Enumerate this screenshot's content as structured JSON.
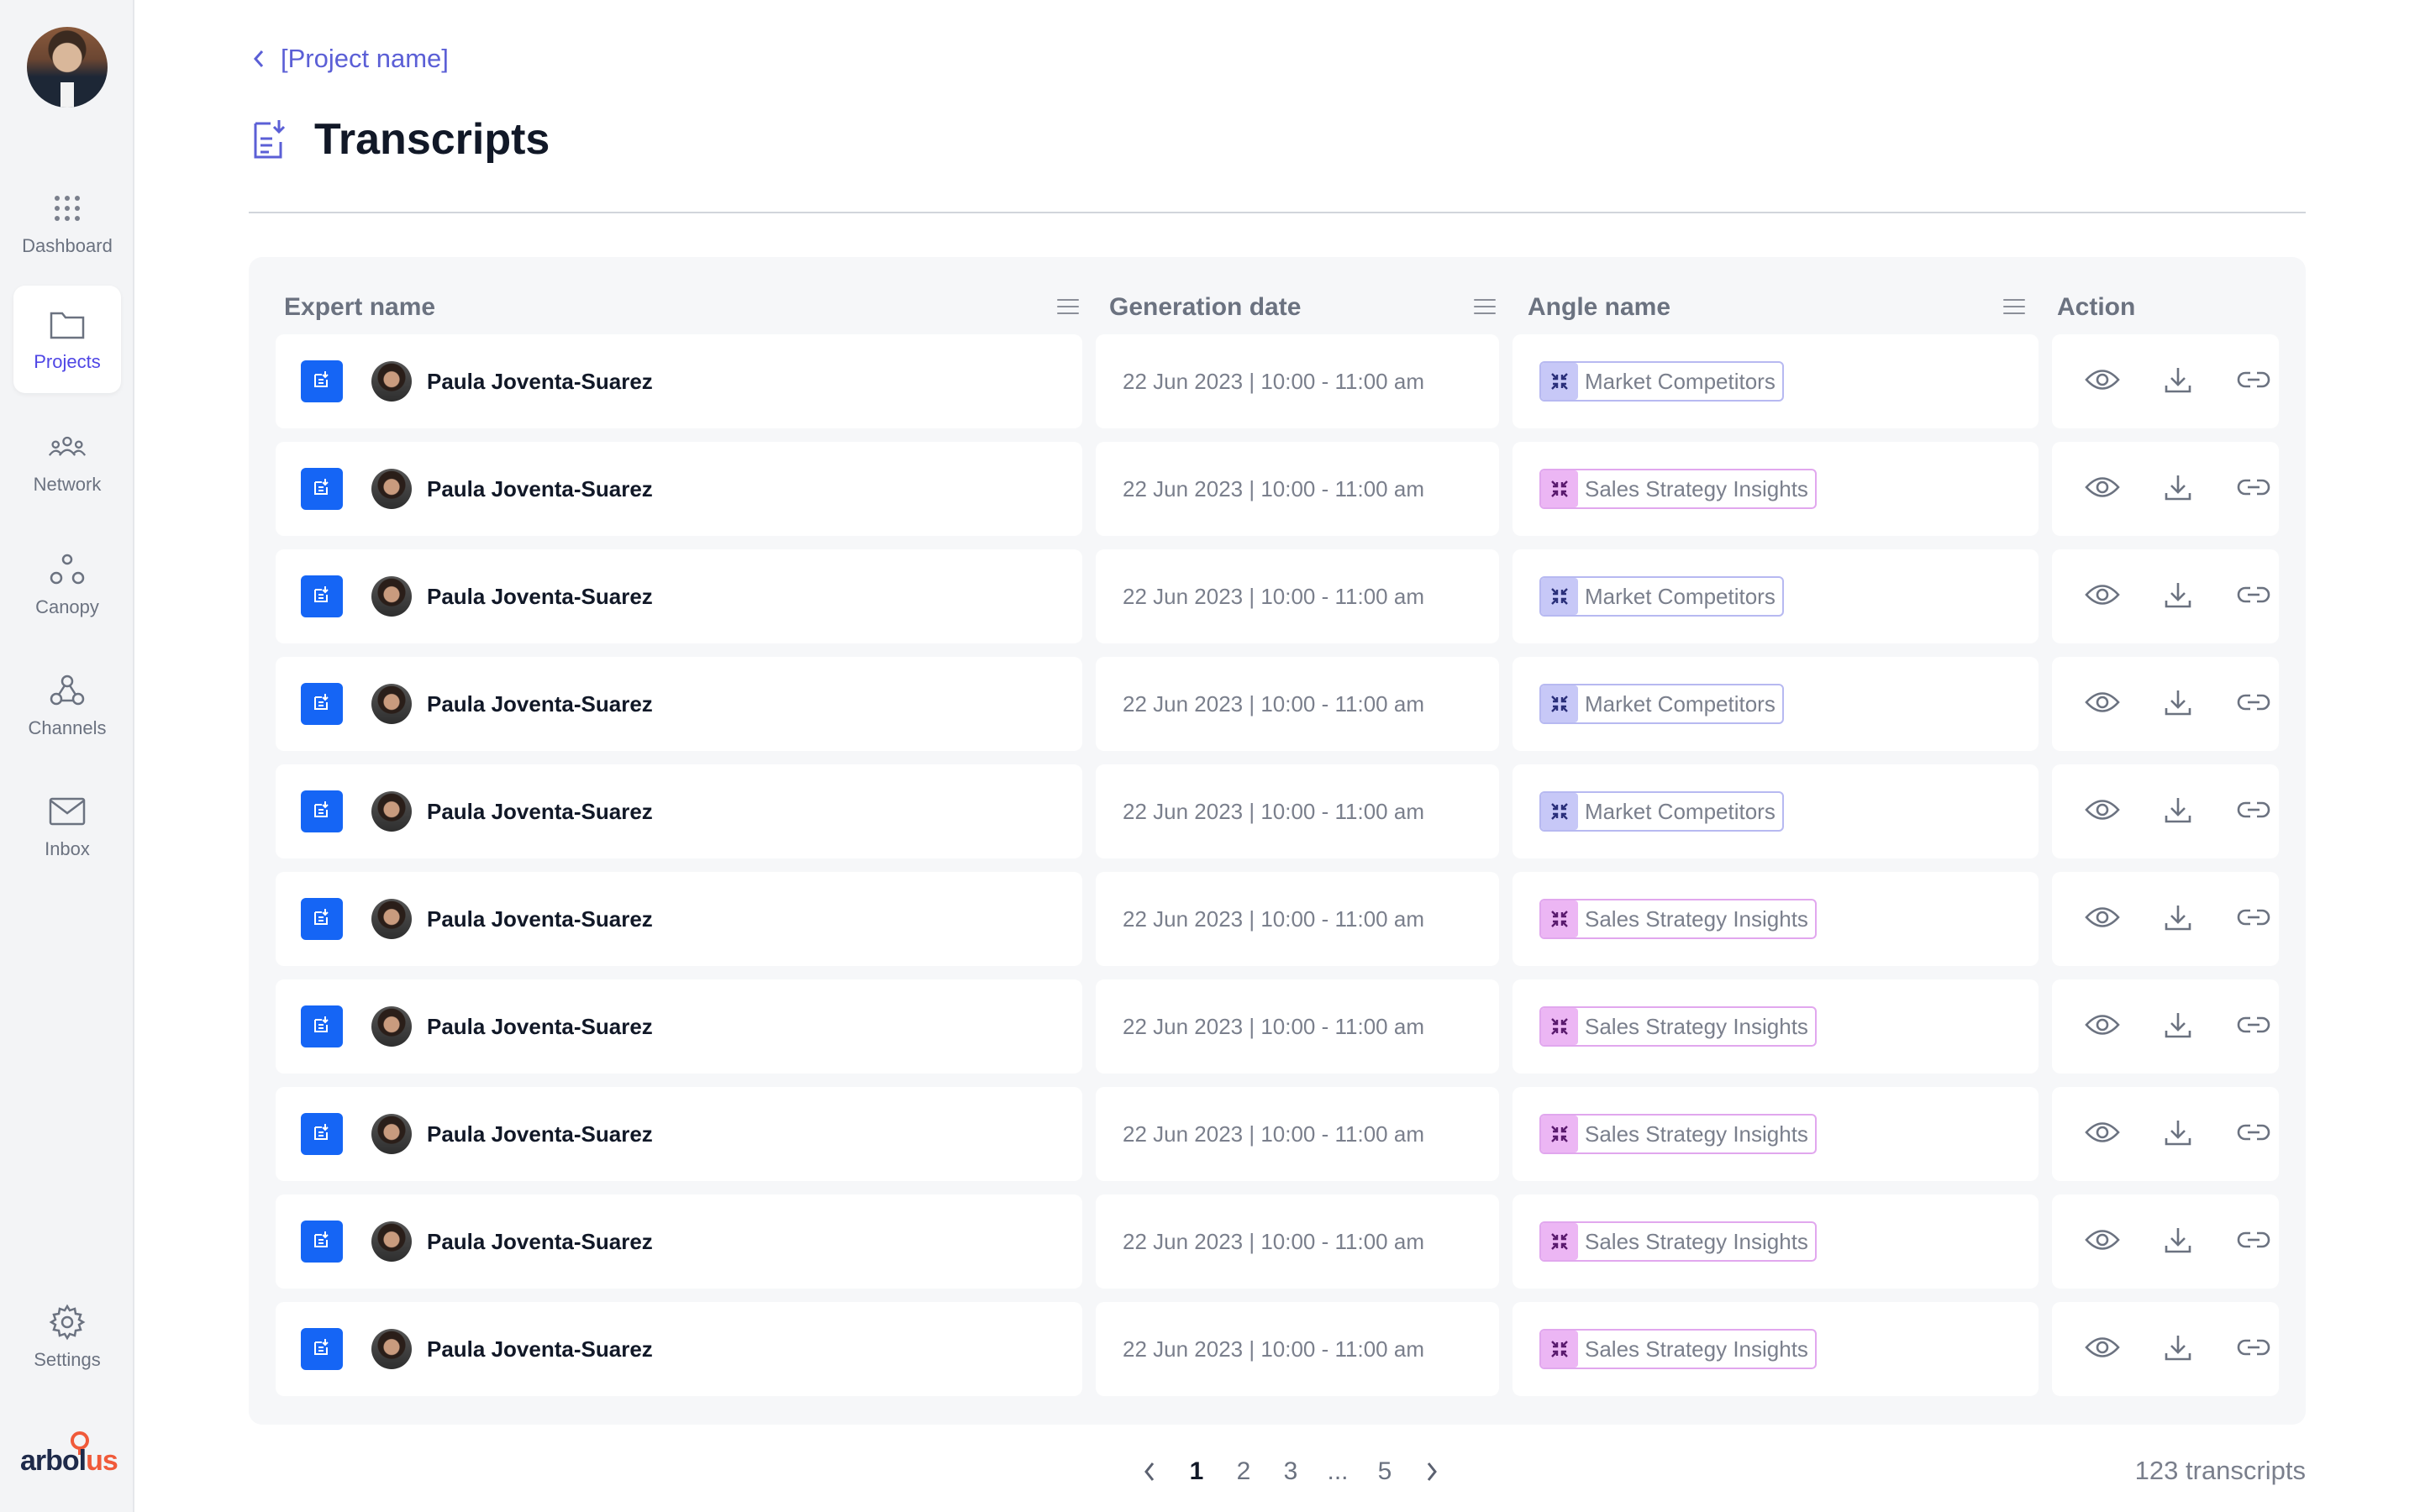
{
  "sidebar": {
    "items": [
      {
        "label": "Dashboard",
        "icon": "grid-dots-icon"
      },
      {
        "label": "Projects",
        "icon": "folder-icon",
        "active": true
      },
      {
        "label": "Network",
        "icon": "people-icon"
      },
      {
        "label": "Canopy",
        "icon": "canopy-icon"
      },
      {
        "label": "Channels",
        "icon": "channels-icon"
      },
      {
        "label": "Inbox",
        "icon": "mail-icon"
      }
    ],
    "settings_label": "Settings",
    "logo_text": "arbolus"
  },
  "breadcrumb": {
    "label": "[Project name]"
  },
  "page": {
    "title": "Transcripts"
  },
  "table": {
    "columns": {
      "expert": "Expert name",
      "date": "Generation date",
      "angle": "Angle name",
      "action": "Action"
    },
    "rows": [
      {
        "expert": "Paula Joventa-Suarez",
        "date": "22 Jun 2023 | 10:00 - 11:00 am",
        "angle": "Market Competitors",
        "angle_color": "blue"
      },
      {
        "expert": "Paula Joventa-Suarez",
        "date": "22 Jun 2023 | 10:00 - 11:00 am",
        "angle": "Sales Strategy Insights",
        "angle_color": "pink"
      },
      {
        "expert": "Paula Joventa-Suarez",
        "date": "22 Jun 2023 | 10:00 - 11:00 am",
        "angle": "Market Competitors",
        "angle_color": "blue"
      },
      {
        "expert": "Paula Joventa-Suarez",
        "date": "22 Jun 2023 | 10:00 - 11:00 am",
        "angle": "Market Competitors",
        "angle_color": "blue"
      },
      {
        "expert": "Paula Joventa-Suarez",
        "date": "22 Jun 2023 | 10:00 - 11:00 am",
        "angle": "Market Competitors",
        "angle_color": "blue"
      },
      {
        "expert": "Paula Joventa-Suarez",
        "date": "22 Jun 2023 | 10:00 - 11:00 am",
        "angle": "Sales Strategy Insights",
        "angle_color": "pink"
      },
      {
        "expert": "Paula Joventa-Suarez",
        "date": "22 Jun 2023 | 10:00 - 11:00 am",
        "angle": "Sales Strategy Insights",
        "angle_color": "pink"
      },
      {
        "expert": "Paula Joventa-Suarez",
        "date": "22 Jun 2023 | 10:00 - 11:00 am",
        "angle": "Sales Strategy Insights",
        "angle_color": "pink"
      },
      {
        "expert": "Paula Joventa-Suarez",
        "date": "22 Jun 2023 | 10:00 - 11:00 am",
        "angle": "Sales Strategy Insights",
        "angle_color": "pink"
      },
      {
        "expert": "Paula Joventa-Suarez",
        "date": "22 Jun 2023 | 10:00 - 11:00 am",
        "angle": "Sales Strategy Insights",
        "angle_color": "pink"
      }
    ]
  },
  "pagination": {
    "pages": [
      "1",
      "2",
      "3",
      "...",
      "5"
    ],
    "current": "1",
    "total_label": "123 transcripts"
  },
  "colors": {
    "accent": "#4f46e5",
    "doc_button": "#1565f5",
    "tag_blue": "#c7c8f7",
    "tag_pink": "#ecb6f4"
  }
}
